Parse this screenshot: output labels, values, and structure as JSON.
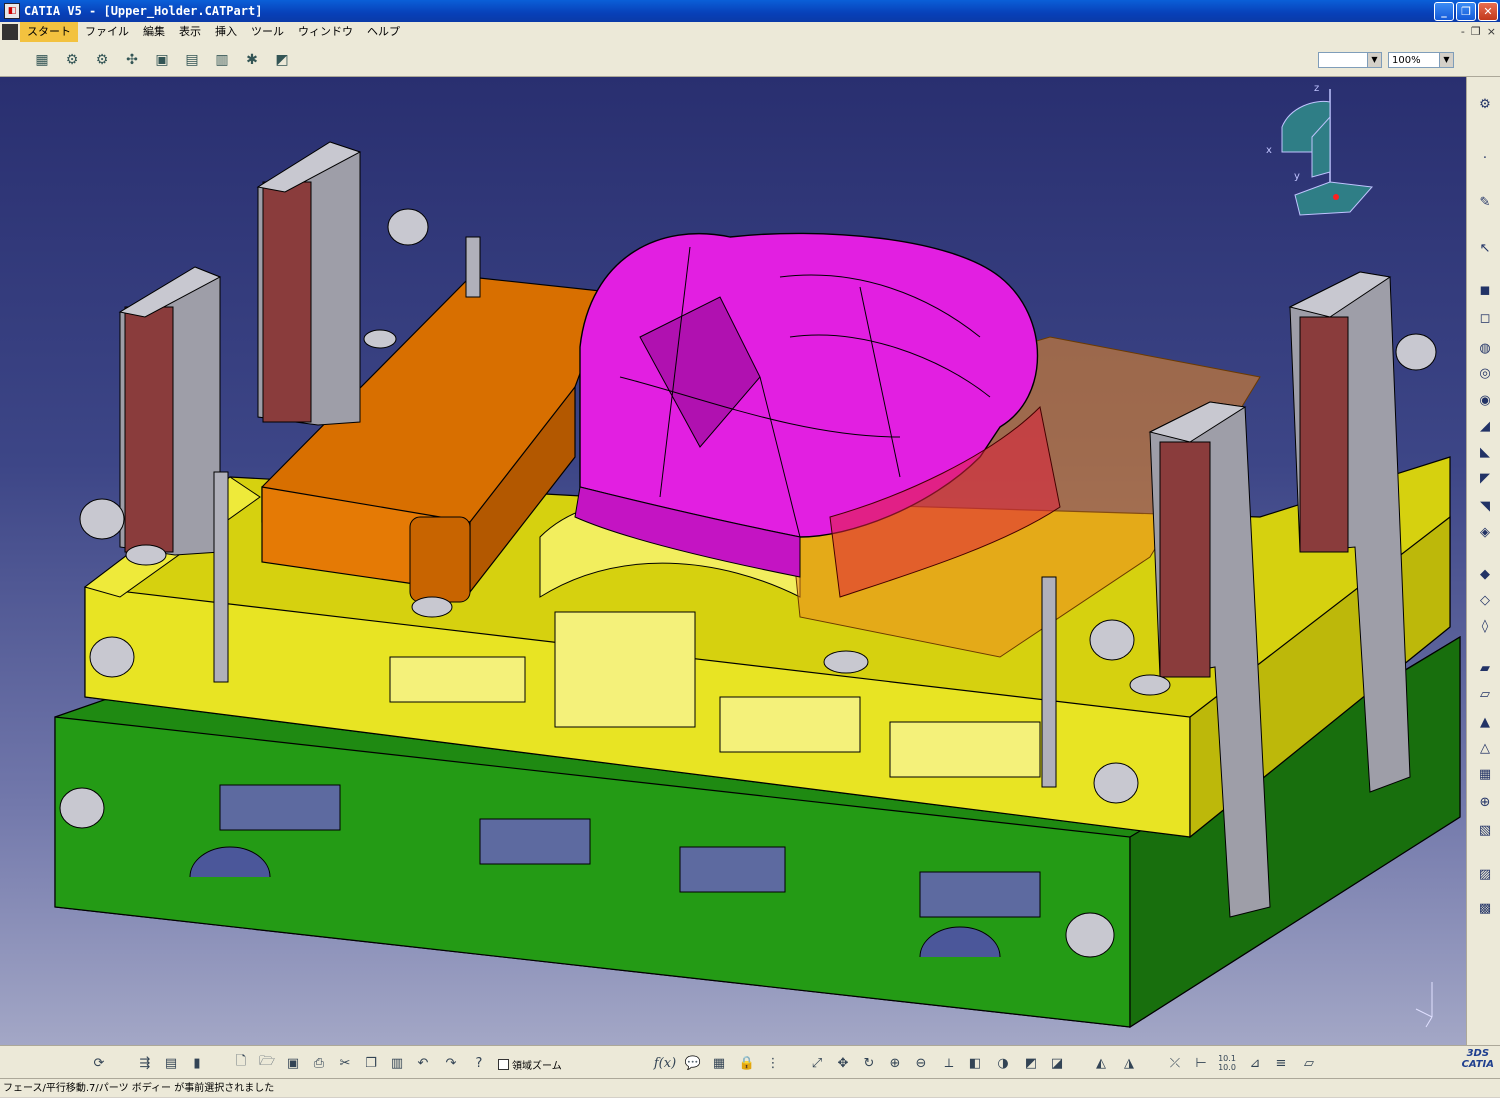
{
  "window": {
    "title": "CATIA V5 - [Upper_Holder.CATPart]",
    "buttons": {
      "minimize": "_",
      "restore": "❐",
      "close": "✕"
    }
  },
  "menubar": {
    "items": [
      "スタート",
      "ファイル",
      "編集",
      "表示",
      "挿入",
      "ツール",
      "ウィンドウ",
      "ヘルプ"
    ],
    "mdi_controls": [
      "-",
      "❐",
      "×"
    ]
  },
  "toolbar_top": {
    "icons": [
      "assembly-icon",
      "gear-icon",
      "gears-icon",
      "move-icon",
      "structure-icon",
      "layout-icon",
      "catalog-icon",
      "analysis-icon",
      "section-icon"
    ],
    "combo_value": "",
    "zoom_value": "100%"
  },
  "compass": {
    "x_label": "x",
    "y_label": "y",
    "z_label": "z"
  },
  "model": {
    "colors": {
      "background_top": "#292f70",
      "background_bottom": "#a3a7c6",
      "lower_plate": "#1f8a12",
      "upper_holder": "#e3df1a",
      "pad_orange": "#e07400",
      "punch_magenta": "#e21fe1",
      "guide_post": "#9e9ea8",
      "post_side": "#8a3c3c"
    }
  },
  "toolbar_right": {
    "icons": [
      "compass-icon",
      "point-icon",
      "sketch-icon",
      "select-icon",
      "pad-icon",
      "pocket-icon",
      "shaft-icon",
      "groove-icon",
      "hole-icon",
      "rib-icon",
      "slot-icon",
      "stiffener-icon",
      "loft-icon",
      "thickness-icon",
      "draft-icon",
      "fillet-icon",
      "chamfer-icon",
      "shell-icon",
      "split-icon",
      "thick-surface-icon",
      "close-surface-icon",
      "sew-icon",
      "boolean-icon",
      "pattern-icon",
      "transform-icon",
      "measure-icon"
    ]
  },
  "toolbar_bottom": {
    "zoom_area_label": "領域ズーム",
    "formula_label": "f(x)",
    "ratio_label": "10.1 10.0",
    "icons": [
      "update-icon",
      "xref-icon",
      "manage-icon",
      "save-icon",
      "new-icon",
      "open-icon",
      "save-disk-icon",
      "print-icon",
      "cut-icon",
      "copy-icon",
      "paste-icon",
      "undo-icon",
      "redo-icon",
      "help-icon",
      "comment-icon",
      "table-icon",
      "lock-icon",
      "tree-icon",
      "fit-all-icon",
      "pan-icon",
      "rotate-icon",
      "zoom-in-icon",
      "zoom-out-icon",
      "normal-view-icon",
      "iso-view-icon",
      "shading-icon",
      "hide-show-icon",
      "swap-icon",
      "publish-icon",
      "sketcher-icon",
      "axis-icon",
      "dimension-icon",
      "measure-item-icon",
      "inertia-icon"
    ]
  },
  "catia_logo": {
    "brand": "3DS",
    "name": "CATIA"
  },
  "status": {
    "text": "フェース/平行移動.7/パーツ ボディー が事前選択されました"
  }
}
